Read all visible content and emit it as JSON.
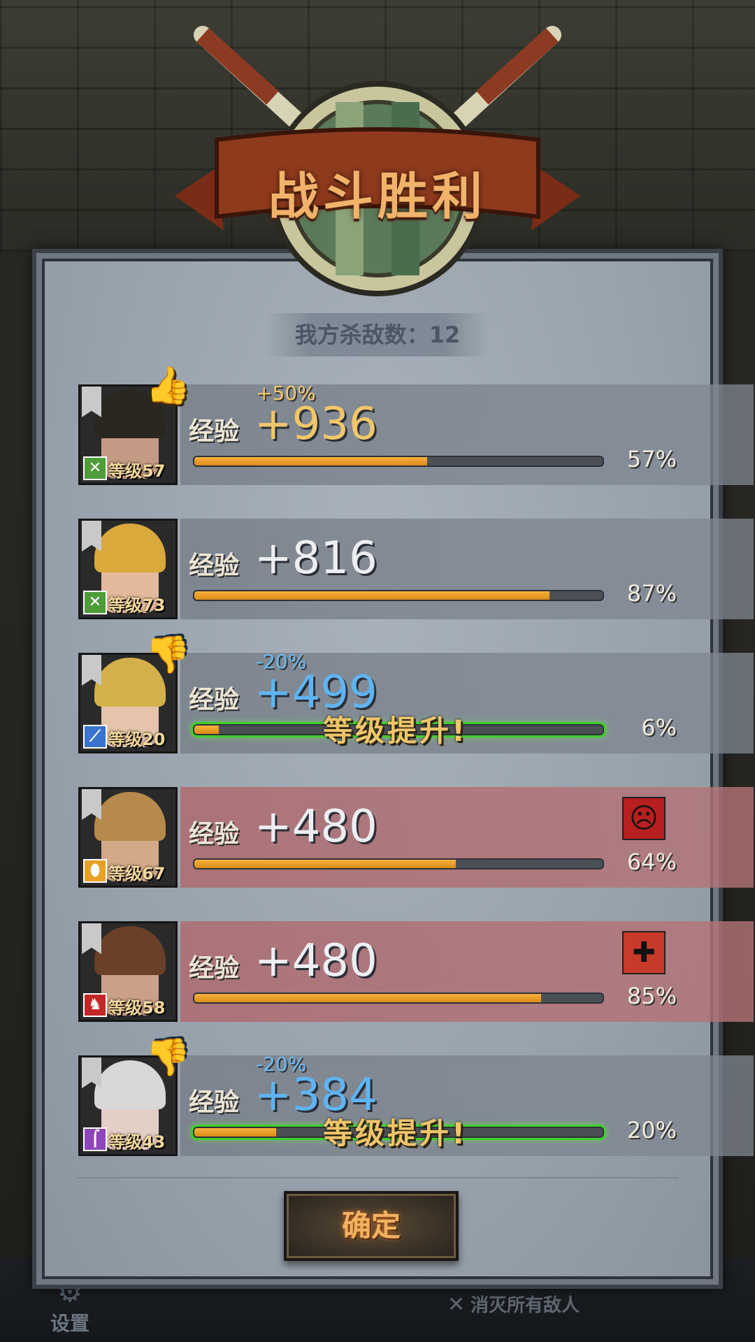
{
  "title": "战斗胜利",
  "kills_text": "我方杀敌数：12",
  "exp_label": "经验",
  "level_up_text": "等级提升!",
  "confirm_label": "确定",
  "background": {
    "settings_label": "设置",
    "hint_text": "消灭所有敌人"
  },
  "heroes": [
    {
      "level": "等级57",
      "class_icon": "crossed-swords-icon",
      "class_color": "#4e9d3a",
      "bonus": "+50%",
      "bonus_type": "positive",
      "exp": "+936",
      "progress": 57,
      "percent_text": "57%",
      "level_up": false,
      "status_icon": null,
      "highlight": "none"
    },
    {
      "level": "等级73",
      "class_icon": "crossed-swords-icon",
      "class_color": "#4e9d3a",
      "bonus": "",
      "bonus_type": "none",
      "exp": "+816",
      "progress": 87,
      "percent_text": "87%",
      "level_up": false,
      "status_icon": null,
      "highlight": "none"
    },
    {
      "level": "等级20",
      "class_icon": "sword-icon",
      "class_color": "#3a73d0",
      "bonus": "-20%",
      "bonus_type": "negative",
      "exp": "+499",
      "progress": 6,
      "percent_text": "6%",
      "level_up": true,
      "status_icon": null,
      "highlight": "none"
    },
    {
      "level": "等级67",
      "class_icon": "shield-icon",
      "class_color": "#e6a126",
      "bonus": "",
      "bonus_type": "none",
      "exp": "+480",
      "progress": 64,
      "percent_text": "64%",
      "level_up": false,
      "status_icon": "stress-face-icon",
      "highlight": "red"
    },
    {
      "level": "等级58",
      "class_icon": "horse-icon",
      "class_color": "#c22828",
      "bonus": "",
      "bonus_type": "none",
      "exp": "+480",
      "progress": 85,
      "percent_text": "85%",
      "level_up": false,
      "status_icon": "injury-icon",
      "highlight": "red"
    },
    {
      "level": "等级43",
      "class_icon": "staff-icon",
      "class_color": "#8e46b8",
      "bonus": "-20%",
      "bonus_type": "negative",
      "exp": "+384",
      "progress": 20,
      "percent_text": "20%",
      "level_up": true,
      "status_icon": null,
      "highlight": "none"
    }
  ]
}
